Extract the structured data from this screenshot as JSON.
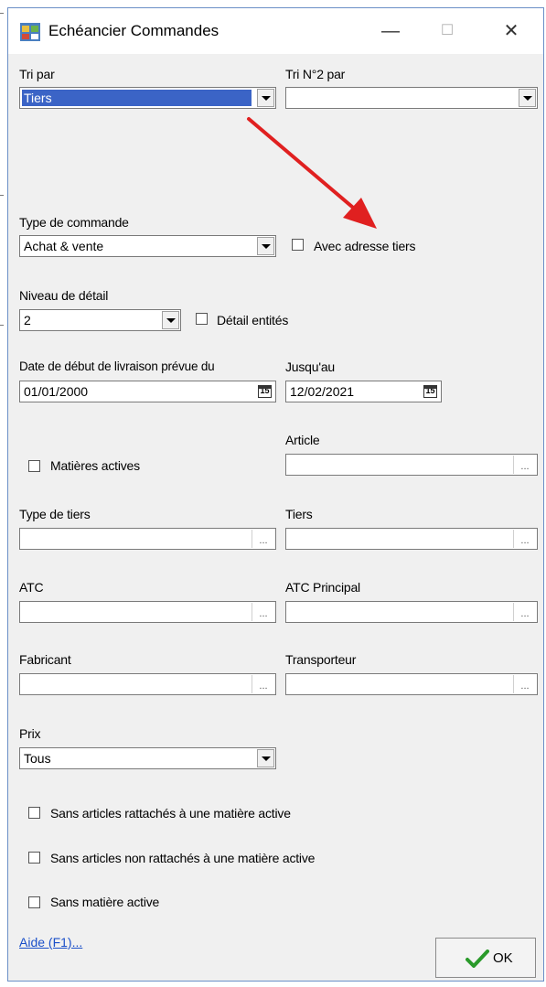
{
  "window": {
    "title": "Echéancier Commandes",
    "minimize_glyph": "—",
    "maximize_glyph": "☐",
    "close_glyph": "✕"
  },
  "sort": {
    "tri_label": "Tri par",
    "tri_value": "Tiers",
    "tri2_label": "Tri N°2 par",
    "tri2_value": ""
  },
  "order_type": {
    "label": "Type de commande",
    "value": "Achat & vente",
    "with_address_label": "Avec adresse tiers",
    "with_address_checked": false
  },
  "detail": {
    "label": "Niveau de détail",
    "value": "2",
    "entities_label": "Détail entités",
    "entities_checked": false
  },
  "dates": {
    "start_label": "Date de début de livraison prévue du",
    "start_value": "01/01/2000",
    "end_label": "Jusqu'au",
    "end_value": "12/02/2021",
    "calendar_glyph": "15"
  },
  "filters": {
    "active_materials_label": "Matières actives",
    "active_materials_checked": false,
    "article_label": "Article",
    "article_value": "",
    "third_party_type_label": "Type de tiers",
    "third_party_type_value": "",
    "third_party_label": "Tiers",
    "third_party_value": "",
    "atc_label": "ATC",
    "atc_value": "",
    "atc_principal_label": "ATC Principal",
    "atc_principal_value": "",
    "manufacturer_label": "Fabricant",
    "manufacturer_value": "",
    "carrier_label": "Transporteur",
    "carrier_value": "",
    "ellipsis": "..."
  },
  "price": {
    "label": "Prix",
    "value": "Tous"
  },
  "options": [
    {
      "label": "Sans articles rattachés à une matière active",
      "checked": false
    },
    {
      "label": "Sans articles non rattachés à une matière active",
      "checked": false
    },
    {
      "label": "Sans matière active",
      "checked": false
    }
  ],
  "footer": {
    "help_link": "Aide (F1)...",
    "ok_label": "OK"
  },
  "colors": {
    "selection": "#3b64c6",
    "annotation_arrow": "#e02020",
    "ok_check": "#2a9a2a",
    "link": "#1a4fc9"
  }
}
